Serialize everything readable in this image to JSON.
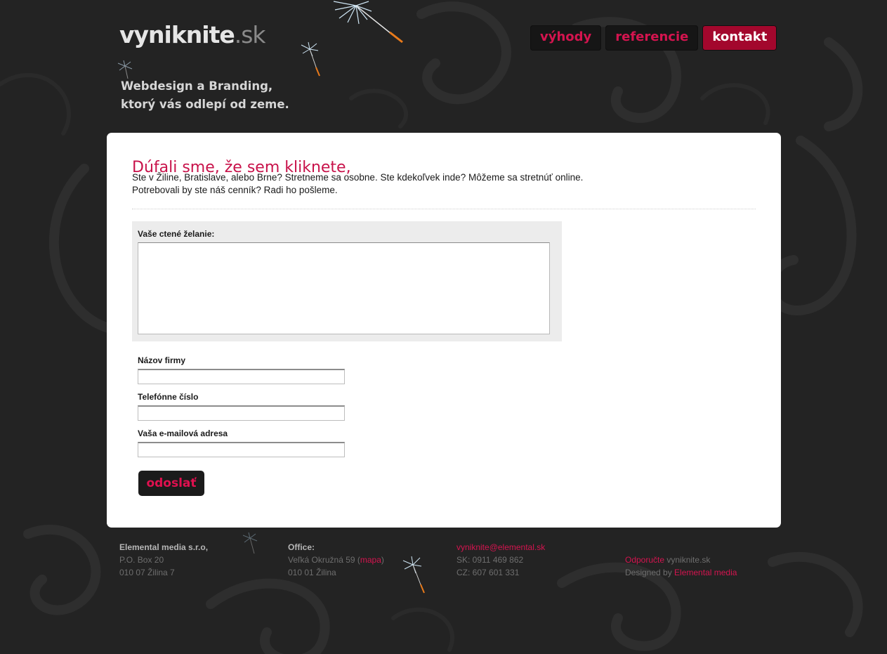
{
  "site": {
    "logo_name": "vyniknite",
    "logo_tld": ".sk"
  },
  "tagline": {
    "line1": "Webdesign a Branding,",
    "line2": "ktorý vás odlepí od zeme."
  },
  "nav": {
    "vyhody": "výhody",
    "referencie": "referencie",
    "kontakt": "kontakt",
    "active": "kontakt"
  },
  "content": {
    "heading": "Dúfali sme, že sem kliknete,",
    "intro_line1": "Ste v Žiline, Bratislave, alebo Brne? Stretneme sa osobne. Ste kdekoľvek inde? Môžeme sa stretnúť online.",
    "intro_line2": "Potrebovali by ste náš cenník? Radi ho pošleme."
  },
  "form": {
    "wish_label": "Vaše ctené želanie:",
    "wish_value": "",
    "company_label": "Názov firmy",
    "company_value": "",
    "phone_label": "Telefónne číslo",
    "phone_value": "",
    "email_label": "Vaša e-mailová adresa",
    "email_value": "",
    "submit_label": "odoslať"
  },
  "footer": {
    "company": {
      "title": "Elemental media s.r.o,",
      "line1": "P.O. Box 20",
      "line2": "010 07 Žilina 7"
    },
    "office": {
      "title": "Office:",
      "street": "Veľká Okružná 59 (",
      "map_link": "mapa",
      "street_end": ")",
      "city": "010 01 Žilina"
    },
    "contact": {
      "email": "vyniknite@elemental.sk",
      "sk": "SK: 0911 469 862",
      "cz": "CZ: 607 601 331"
    },
    "credits": {
      "recommend_link": "Odporučte",
      "recommend_rest": " vyniknite.sk",
      "designed_by": "Designed by ",
      "designer_link": "Elemental media"
    }
  },
  "colors": {
    "accent": "#c8124a",
    "nav_active_bg": "#a3072d",
    "page_bg": "#232323",
    "panel_bg": "#ffffff"
  },
  "icons": {
    "decoration": "dandelion-seed-icon"
  }
}
